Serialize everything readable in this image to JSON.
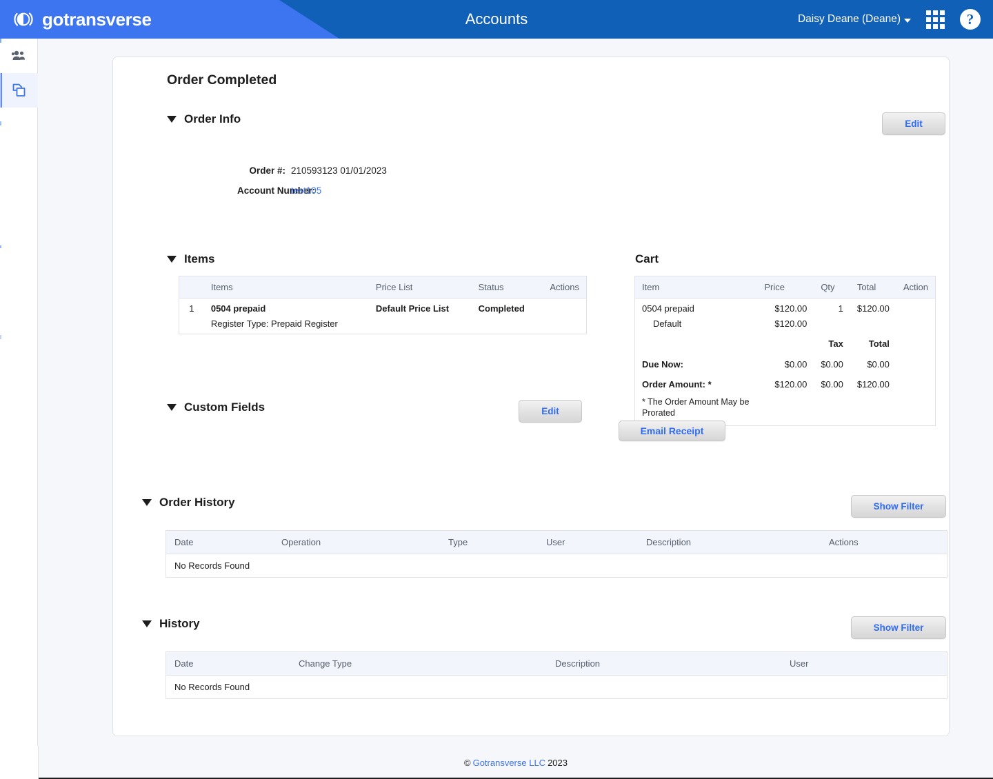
{
  "header": {
    "brand": "gotransverse",
    "title": "Accounts",
    "user": "Daisy Deane (Deane)",
    "icons": {
      "caret": "chevron-down-icon",
      "apps": "apps-grid-icon",
      "help": "?"
    }
  },
  "sidebar": {
    "items": [
      {
        "name": "accounts",
        "icon": "people-icon",
        "active": false
      },
      {
        "name": "orders",
        "icon": "documents-copy-icon",
        "active": true
      }
    ]
  },
  "page": {
    "title": "Order Completed"
  },
  "order_info": {
    "section_title": "Order Info",
    "edit_label": "Edit",
    "fields": [
      {
        "label": "Order #:",
        "value": "210593123 01/01/2023",
        "is_link": false
      },
      {
        "label": "Account Number:",
        "value": "test105",
        "is_link": true
      }
    ]
  },
  "items": {
    "section_title": "Items",
    "columns": [
      "",
      "Items",
      "Price List",
      "Status",
      "Actions"
    ],
    "rows": [
      {
        "index": "1",
        "item": "0504 prepaid",
        "price_list": "Default Price List",
        "status": "Completed",
        "actions": "",
        "sub": "Register Type: Prepaid Register"
      }
    ]
  },
  "custom_fields": {
    "section_title": "Custom Fields",
    "edit_label": "Edit"
  },
  "cart": {
    "section_title": "Cart",
    "columns": [
      "Item",
      "Price",
      "Qty",
      "Total",
      "Action"
    ],
    "rows": [
      {
        "item": "0504 prepaid",
        "price": "$120.00",
        "qty": "1",
        "total": "$120.00",
        "action": ""
      },
      {
        "item": "Default",
        "price": "$120.00",
        "qty": "",
        "total": "",
        "action": "",
        "muted": true
      }
    ],
    "summary_headers": {
      "tax": "Tax",
      "total": "Total"
    },
    "summary_rows": [
      {
        "label": "Due Now:",
        "amount": "$0.00",
        "tax": "$0.00",
        "total": "$0.00"
      },
      {
        "label": "Order Amount: *",
        "amount": "$120.00",
        "tax": "$0.00",
        "total": "$120.00"
      }
    ],
    "note": "* The Order Amount May be Prorated",
    "email_receipt_label": "Email Receipt"
  },
  "order_history": {
    "section_title": "Order History",
    "filter_label": "Show Filter",
    "columns": [
      "Date",
      "Operation",
      "Type",
      "User",
      "Description",
      "Actions"
    ],
    "empty_message": "No Records Found"
  },
  "history": {
    "section_title": "History",
    "filter_label": "Show Filter",
    "columns": [
      "Date",
      "Change Type",
      "Description",
      "User"
    ],
    "empty_message": "No Records Found"
  },
  "footer": {
    "copyright_symbol": "©",
    "link_text": "Gotransverse LLC",
    "year": "2023"
  },
  "colors": {
    "header_blue": "#1160b8",
    "header_accent": "#3d74f0",
    "link_blue": "#3d74f0",
    "button_text": "#2f6bf5",
    "page_bg": "#f5f7fa",
    "table_head": "#f2f6fc"
  }
}
